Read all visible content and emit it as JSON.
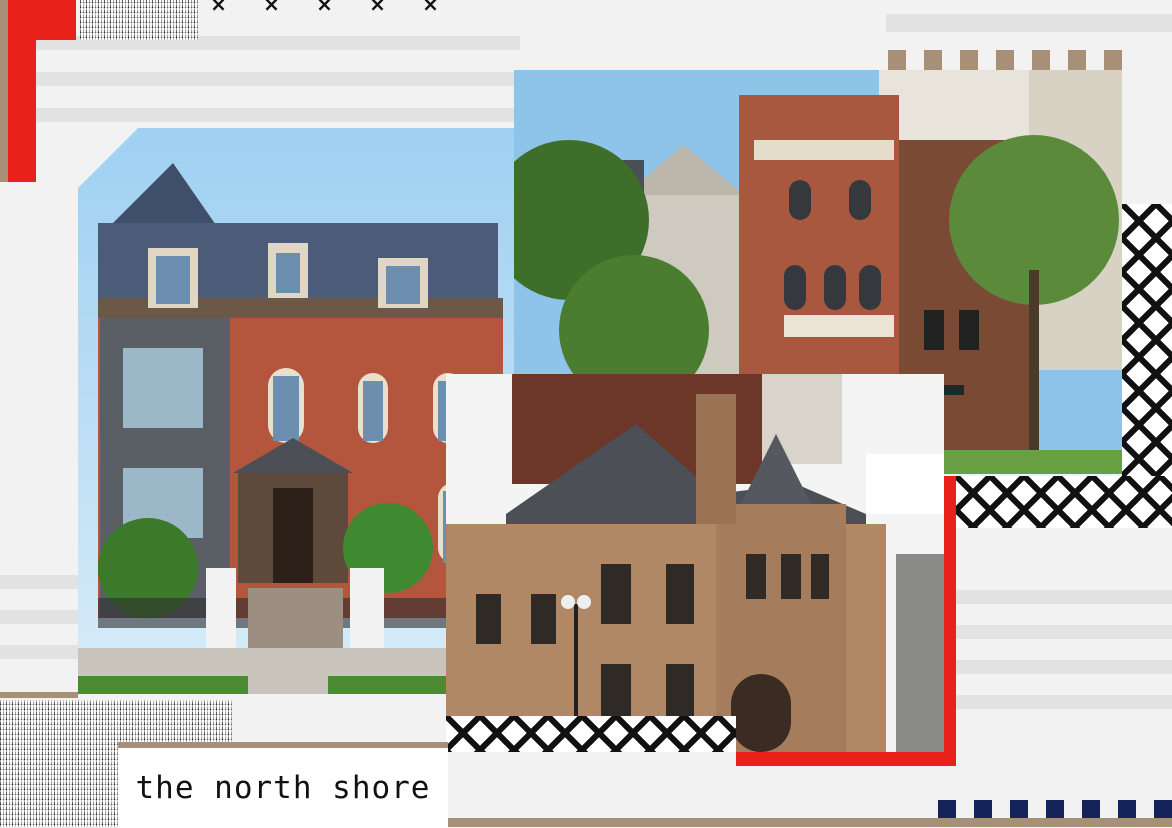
{
  "caption": "the north shore",
  "colors": {
    "accent_red": "#e8221b",
    "tan": "#a89078",
    "navy": "#14245a",
    "background": "#f2f2f2"
  },
  "decor": {
    "x_marks": [
      "×",
      "×",
      "×",
      "×",
      "×"
    ]
  },
  "photos": [
    {
      "icon": "italianate-mansion-image"
    },
    {
      "icon": "rowhouses-trees-image"
    },
    {
      "icon": "romanesque-mansion-image"
    }
  ]
}
